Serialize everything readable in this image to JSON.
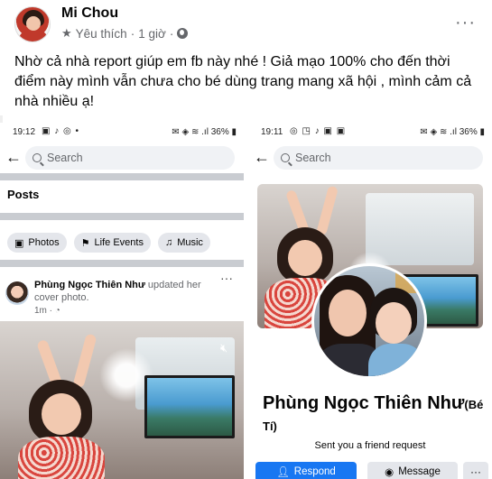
{
  "post": {
    "author": "Mi Chou",
    "audience_label": "Yêu thích",
    "separator": "·",
    "time": "1 giờ",
    "more_label": "···",
    "caption": "Nhờ cả nhà report giúp em fb này nhé ! Giả mạo 100% cho đến thời điểm này mình vẫn chưa cho bé dùng trang mang xã hội , mình cảm cả nhà nhiều ạ!"
  },
  "screenshot_left": {
    "status_time": "19:12",
    "status_icons_left": "▣ ♪ ◎ •",
    "status_icons_right": "✉ ◈ ≋ .ıl 36% ▮",
    "search_placeholder": "Search",
    "posts_title": "Posts",
    "chips": [
      {
        "label": "Photos",
        "icon": "photos-icon"
      },
      {
        "label": "Life Events",
        "icon": "flag-icon"
      },
      {
        "label": "Music",
        "icon": "music-icon"
      }
    ],
    "feed": {
      "name": "Phùng Ngọc Thiên Như",
      "action": " updated her cover photo.",
      "time": "1m · ◔",
      "dots": "···"
    }
  },
  "screenshot_right": {
    "status_time": "19:11",
    "status_icons_left": "◎ ◳ ♪ ▣ ▣",
    "status_icons_right": "✉ ◈ ≋ .ıl 36% ▮",
    "search_placeholder": "Search",
    "profile_name": "Phùng Ngọc Thiên Như",
    "profile_nick": "(Bé Tí)",
    "request_text": "Sent you a friend request",
    "respond_label": "Respond",
    "message_label": "Message",
    "more_label": "···"
  },
  "colors": {
    "facebook_blue": "#1877f2",
    "secondary_text": "#65676b",
    "chip_bg": "#e4e6eb"
  }
}
